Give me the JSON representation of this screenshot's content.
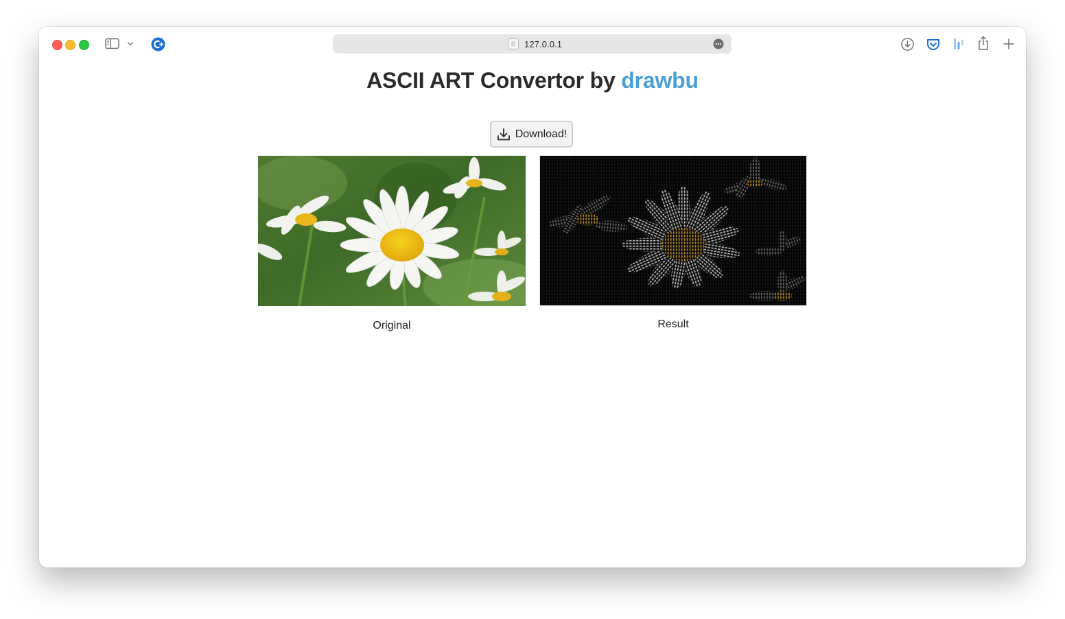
{
  "browser": {
    "url": "127.0.0.1",
    "icons": {
      "sidebar": "sidebar-icon",
      "chevron": "chevron-down-icon",
      "extension": "c-plus-extension-icon",
      "page": "page-icon",
      "more": "ellipsis-icon",
      "downloads": "download-circle-icon",
      "pocket": "pocket-icon",
      "bars": "bars-extension-icon",
      "share": "share-icon",
      "new_tab": "plus-icon"
    }
  },
  "page": {
    "title_prefix": "ASCII ART Convertor by ",
    "title_brand": "drawbu",
    "download_label": "Download!",
    "original_caption": "Original",
    "result_caption": "Result"
  },
  "colors": {
    "brand": "#4aa0d5",
    "title": "#2b2b2b",
    "accent_blue": "#1a6fd6"
  }
}
